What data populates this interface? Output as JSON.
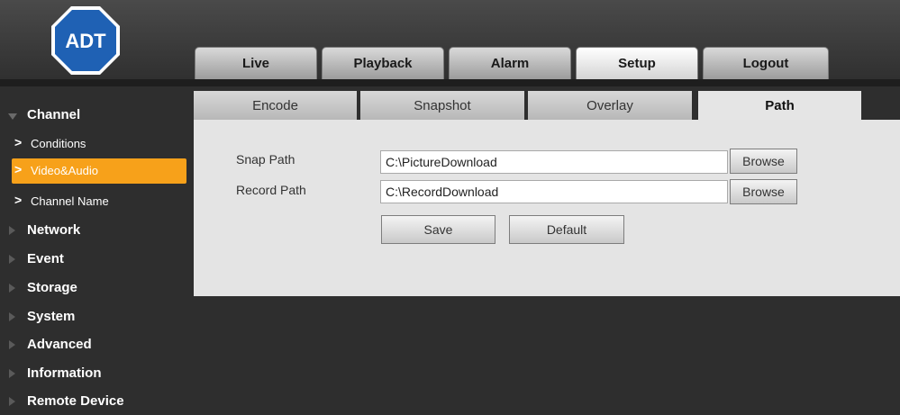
{
  "brand": {
    "logo_text": "ADT",
    "logo_color": "#1f61b4"
  },
  "nav": {
    "tabs": [
      {
        "label": "Live"
      },
      {
        "label": "Playback"
      },
      {
        "label": "Alarm"
      },
      {
        "label": "Setup",
        "active": true
      },
      {
        "label": "Logout"
      }
    ]
  },
  "sidebar": {
    "channel": {
      "label": "Channel",
      "items": [
        {
          "label": "Conditions"
        },
        {
          "label": "Video&Audio",
          "selected": true
        },
        {
          "label": "Channel Name"
        }
      ]
    },
    "groups": [
      {
        "label": "Network"
      },
      {
        "label": "Event"
      },
      {
        "label": "Storage"
      },
      {
        "label": "System"
      },
      {
        "label": "Advanced"
      },
      {
        "label": "Information"
      },
      {
        "label": "Remote Device"
      }
    ]
  },
  "subtabs": [
    {
      "label": "Encode"
    },
    {
      "label": "Snapshot"
    },
    {
      "label": "Overlay"
    },
    {
      "label": "Path",
      "active": true
    }
  ],
  "form": {
    "snap_path_label": "Snap Path",
    "snap_path_value": "C:\\PictureDownload",
    "record_path_label": "Record Path",
    "record_path_value": "C:\\RecordDownload",
    "browse_label": "Browse",
    "save_label": "Save",
    "default_label": "Default"
  },
  "colors": {
    "accent": "#f7a11a",
    "background": "#2e2e2e",
    "panel": "#e4e4e4"
  }
}
